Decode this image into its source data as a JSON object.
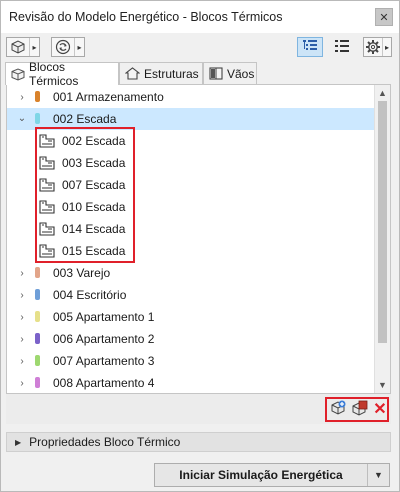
{
  "window": {
    "title": "Revisão do Modelo Energético - Blocos Térmicos",
    "close_glyph": "✕"
  },
  "toolbar": {
    "left_buttons": [
      {
        "name": "thermal-block-icon"
      },
      {
        "name": "refresh-icon"
      }
    ],
    "right_buttons": [
      {
        "name": "tree-view-icon",
        "active": true
      },
      {
        "name": "list-view-icon",
        "active": false
      },
      {
        "name": "settings-gear-icon",
        "active": false
      }
    ],
    "arrow_glyph": "▸"
  },
  "tabs": [
    {
      "label": "Blocos Térmicos",
      "icon": "thermal-blocks-icon",
      "active": true
    },
    {
      "label": "Estruturas",
      "icon": "structures-icon",
      "active": false
    },
    {
      "label": "Vãos",
      "icon": "openings-icon",
      "active": false
    }
  ],
  "tree": {
    "items": [
      {
        "label": "001 Armazenamento",
        "color": "#d9822b",
        "expanded": false,
        "selected": false
      },
      {
        "label": "002 Escada",
        "color": "#7fd6e6",
        "expanded": true,
        "selected": true
      },
      {
        "label": "003 Varejo",
        "color": "#e2a58a",
        "expanded": false,
        "selected": false
      },
      {
        "label": "004 Escritório",
        "color": "#6f9fd8",
        "expanded": false,
        "selected": false
      },
      {
        "label": "005 Apartamento 1",
        "color": "#e6e08a",
        "expanded": false,
        "selected": false
      },
      {
        "label": "006 Apartamento 2",
        "color": "#7b62c9",
        "expanded": false,
        "selected": false
      },
      {
        "label": "007 Apartamento 3",
        "color": "#9ed870",
        "expanded": false,
        "selected": false
      },
      {
        "label": "008 Apartamento 4",
        "color": "#cf7fd6",
        "expanded": false,
        "selected": false
      }
    ],
    "children": [
      {
        "label": "002 Escada"
      },
      {
        "label": "003 Escada"
      },
      {
        "label": "007 Escada"
      },
      {
        "label": "010 Escada"
      },
      {
        "label": "014 Escada"
      },
      {
        "label": "015 Escada"
      }
    ],
    "chevron_collapsed": "›",
    "chevron_expanded": "⌄"
  },
  "bottom_tools": [
    {
      "name": "add-block-icon"
    },
    {
      "name": "assign-block-icon"
    },
    {
      "name": "delete-icon",
      "glyph": "✕",
      "color": "#e0202a"
    }
  ],
  "properties": {
    "label": "Propriedades Bloco Térmico",
    "arrow_glyph": "▶"
  },
  "simulation": {
    "label": "Iniciar Simulação Energética",
    "dropdown_glyph": "▼"
  },
  "scroll": {
    "up_glyph": "▲",
    "down_glyph": "▼"
  }
}
